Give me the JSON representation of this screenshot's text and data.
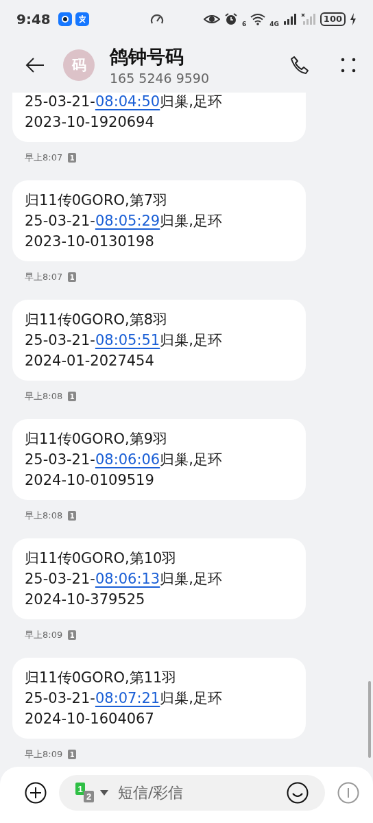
{
  "status_bar": {
    "time": "9:48",
    "battery": "100",
    "network": "4G",
    "wifi_badge": "6"
  },
  "header": {
    "avatar": "码",
    "title": "鸽钟号码",
    "number": "165 5246 9590"
  },
  "messages": [
    {
      "date_prefix": "25-03-21-",
      "time_link": "08:04:50",
      "suffix": "归巢,足环",
      "ring": "2023-10-1920694",
      "timestamp": "早上8:07",
      "sim": "1"
    },
    {
      "title": "归11传0GORO,第7羽",
      "date_prefix": "25-03-21-",
      "time_link": "08:05:29",
      "suffix": "归巢,足环",
      "ring": "2023-10-0130198",
      "timestamp": "早上8:07",
      "sim": "1"
    },
    {
      "title": "归11传0GORO,第8羽",
      "date_prefix": "25-03-21-",
      "time_link": "08:05:51",
      "suffix": "归巢,足环",
      "ring": "2024-01-2027454",
      "timestamp": "早上8:08",
      "sim": "1"
    },
    {
      "title": "归11传0GORO,第9羽",
      "date_prefix": "25-03-21-",
      "time_link": "08:06:06",
      "suffix": "归巢,足环",
      "ring": "2024-10-0109519",
      "timestamp": "早上8:08",
      "sim": "1"
    },
    {
      "title": "归11传0GORO,第10羽",
      "date_prefix": "25-03-21-",
      "time_link": "08:06:13",
      "suffix": "归巢,足环",
      "ring": "2024-10-379525",
      "timestamp": "早上8:09",
      "sim": "1"
    },
    {
      "title": "归11传0GORO,第11羽",
      "date_prefix": "25-03-21-",
      "time_link": "08:07:21",
      "suffix": "归巢,足环",
      "ring": "2024-10-1604067",
      "timestamp": "早上8:09",
      "sim": "1"
    }
  ],
  "composer": {
    "sim_primary": "1",
    "sim_secondary": "2",
    "placeholder": "短信/彩信"
  }
}
